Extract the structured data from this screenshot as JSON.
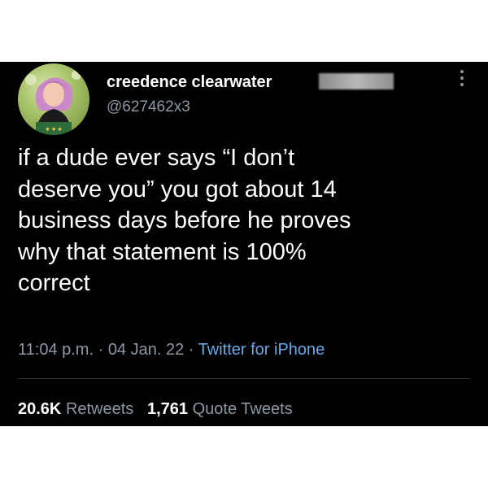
{
  "tweet": {
    "display_name": "creedence clearwater",
    "handle": "@627462x3",
    "text": "if a dude ever says “I don’t\ndeserve you” you got about 14\nbusiness days before he proves\nwhy that statement is 100%\ncorrect",
    "time": "11:04 p.m.",
    "date": "04 Jan. 22",
    "separator": " · ",
    "source": "Twitter for iPhone",
    "avatar_icon": "profile-avatar",
    "more_icon": "more-options-vertical-icon"
  },
  "stats": {
    "retweets_count": "20.6K",
    "retweets_label": "Retweets",
    "quotes_count": "1,761",
    "quotes_label": "Quote Tweets"
  },
  "colors": {
    "background": "#000000",
    "text": "#ffffff",
    "secondary": "#8b98a5",
    "link": "#6aa8e8"
  }
}
